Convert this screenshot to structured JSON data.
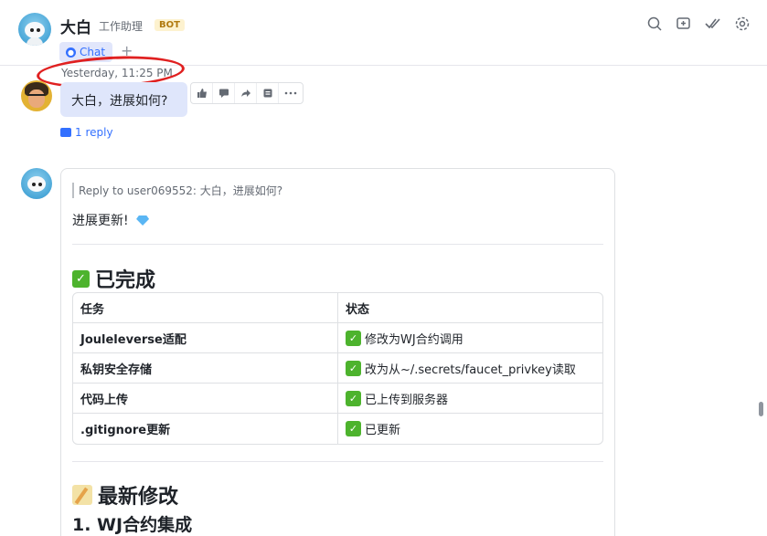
{
  "header": {
    "name": "大白",
    "subtitle": "工作助理",
    "badge": "BOT",
    "tab_label": "Chat",
    "tab_add": "+"
  },
  "timestamp": "Yesterday, 11:25 PM",
  "message1": {
    "text": "大白，进展如何?",
    "reply": "1 reply"
  },
  "message2": {
    "quote": "Reply to user069552:  大白，进展如何?",
    "intro": "进展更新!",
    "section1_title": "已完成",
    "table": {
      "headers": [
        "任务",
        "状态"
      ],
      "rows": [
        [
          "Jouleleverse适配",
          "修改为WJ合约调用"
        ],
        [
          "私钥安全存储",
          "改为从~/.secrets/faucet_privkey读取"
        ],
        [
          "代码上传",
          "已上传到服务器"
        ],
        [
          ".gitignore更新",
          "已更新"
        ]
      ]
    },
    "section2_title": "最新修改",
    "subsection": "1. WJ合约集成"
  },
  "colors": {
    "accent": "#3370ff",
    "bubble": "#dfe6fb",
    "highlight": "#e02020",
    "check": "#4db32d"
  }
}
